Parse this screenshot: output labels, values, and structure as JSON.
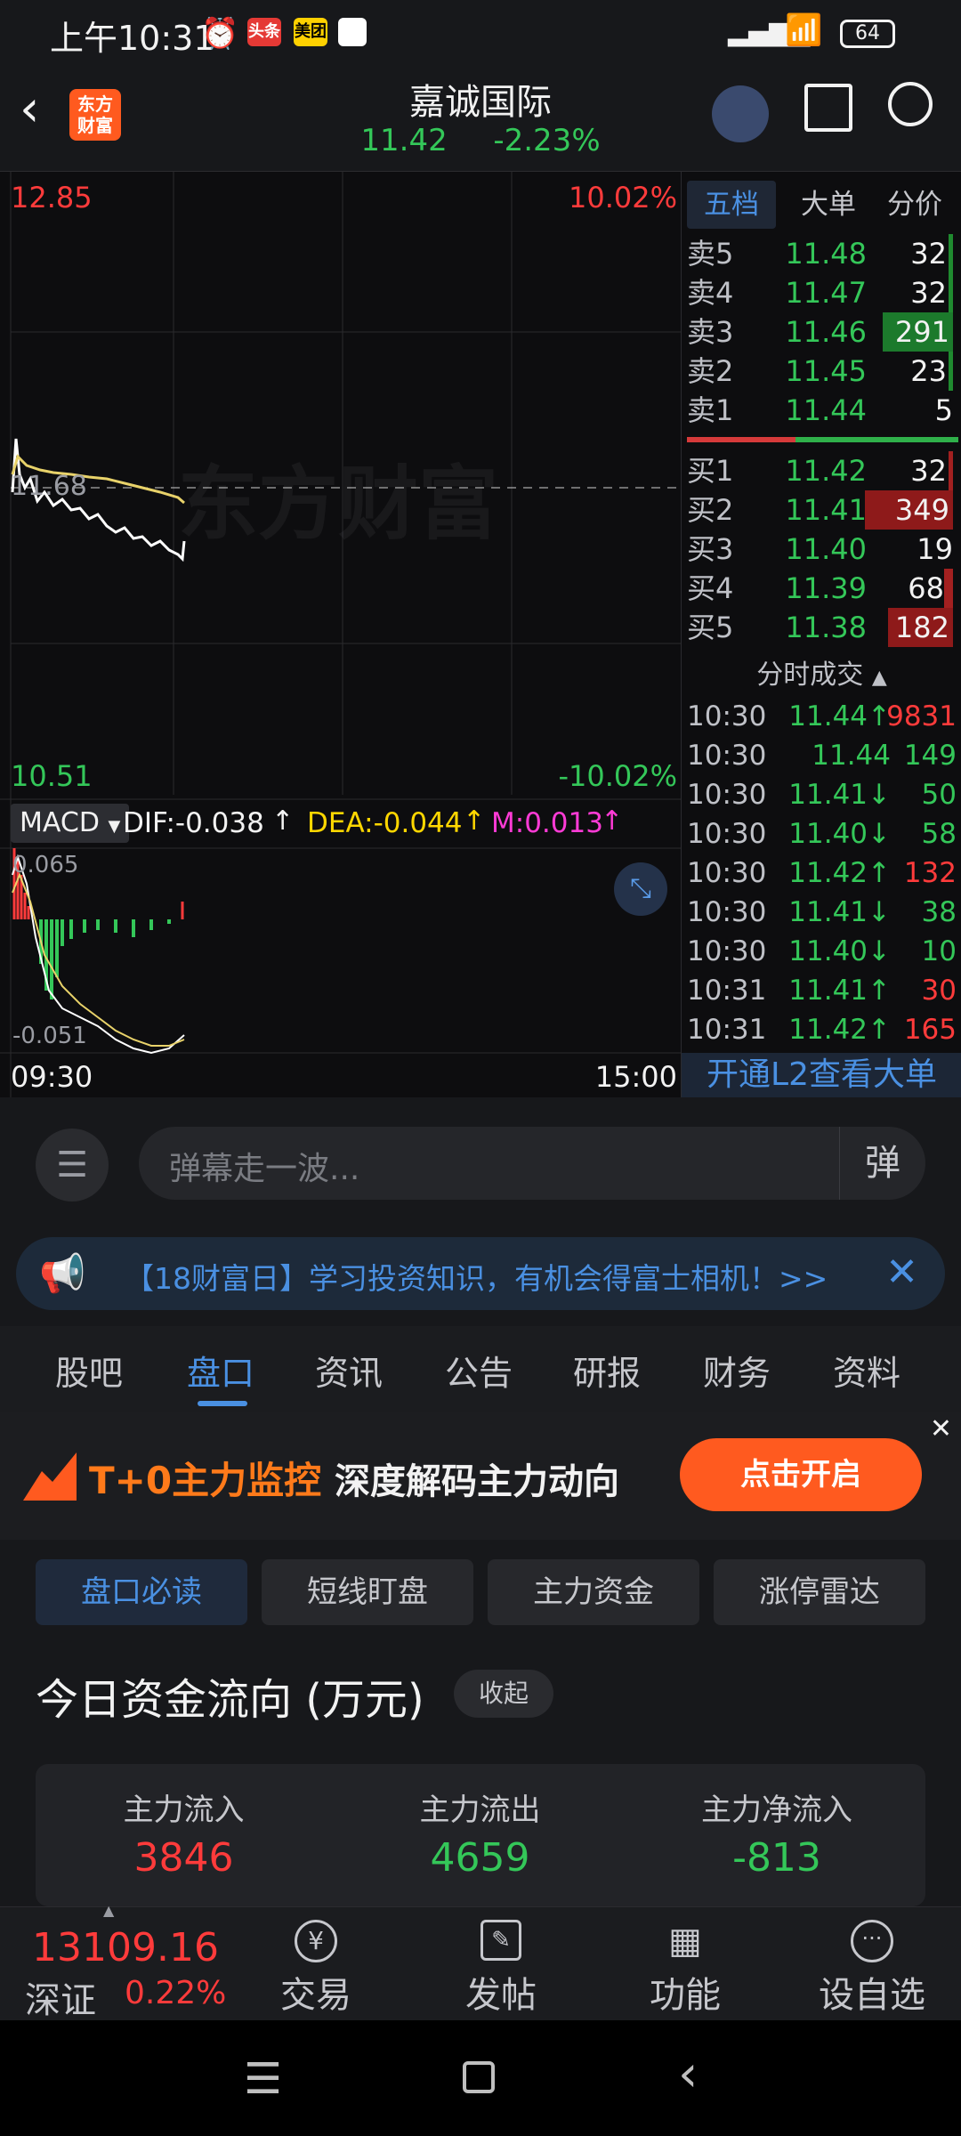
{
  "status": {
    "time": "上午10:31",
    "badges": [
      "头条",
      "美团"
    ],
    "battery": "64"
  },
  "header": {
    "logo_text": "东方\n财富",
    "title": "嘉诚国际",
    "price": "11.42",
    "change": "-2.23%"
  },
  "chart": {
    "top_price": "12.85",
    "top_pct": "10.02%",
    "bottom_price": "10.51",
    "bottom_pct": "-10.02%",
    "ref_price": "11.68",
    "watermark": "东方财富",
    "macd": {
      "label": "MACD",
      "dif": "DIF:-0.038",
      "dea": "DEA:-0.044",
      "m": "M:0.013",
      "top": "0.065",
      "bottom": "-0.051"
    },
    "time_start": "09:30",
    "time_end": "15:00"
  },
  "orderbook": {
    "tabs": [
      "五档",
      "大单",
      "分价"
    ],
    "sell": [
      {
        "label": "卖5",
        "price": "11.48",
        "vol": "32"
      },
      {
        "label": "卖4",
        "price": "11.47",
        "vol": "32"
      },
      {
        "label": "卖3",
        "price": "11.46",
        "vol": "291"
      },
      {
        "label": "卖2",
        "price": "11.45",
        "vol": "23"
      },
      {
        "label": "卖1",
        "price": "11.44",
        "vol": "5"
      }
    ],
    "buy": [
      {
        "label": "买1",
        "price": "11.42",
        "vol": "32"
      },
      {
        "label": "买2",
        "price": "11.41",
        "vol": "349"
      },
      {
        "label": "买3",
        "price": "11.40",
        "vol": "19"
      },
      {
        "label": "买4",
        "price": "11.39",
        "vol": "68"
      },
      {
        "label": "买5",
        "price": "11.38",
        "vol": "182"
      }
    ],
    "trades_title": "分时成交",
    "trades": [
      {
        "time": "10:30",
        "price": "11.44↑",
        "vol": "9831",
        "dir": "up"
      },
      {
        "time": "10:30",
        "price": "11.44",
        "vol": "149",
        "dir": "flat"
      },
      {
        "time": "10:30",
        "price": "11.41↓",
        "vol": "50",
        "dir": "down"
      },
      {
        "time": "10:30",
        "price": "11.40↓",
        "vol": "58",
        "dir": "down"
      },
      {
        "time": "10:30",
        "price": "11.42↑",
        "vol": "132",
        "dir": "up"
      },
      {
        "time": "10:30",
        "price": "11.41↓",
        "vol": "38",
        "dir": "down"
      },
      {
        "time": "10:30",
        "price": "11.40↓",
        "vol": "10",
        "dir": "down"
      },
      {
        "time": "10:31",
        "price": "11.41↑",
        "vol": "30",
        "dir": "up"
      },
      {
        "time": "10:31",
        "price": "11.42↑",
        "vol": "165",
        "dir": "up"
      }
    ],
    "l2_link": "开通L2查看大单"
  },
  "danmaku": {
    "placeholder": "弹幕走一波...",
    "button": "弹"
  },
  "notice": {
    "text": "【18财富日】学习投资知识，有机会得富士相机！>>"
  },
  "tabs": [
    "股吧",
    "盘口",
    "资讯",
    "公告",
    "研报",
    "财务",
    "资料"
  ],
  "ad": {
    "highlight": "T+0主力监控",
    "text": "深度解码主力动向",
    "button": "点击开启"
  },
  "chips": [
    "盘口必读",
    "短线盯盘",
    "主力资金",
    "涨停雷达"
  ],
  "flow": {
    "title": "今日资金流向 (万元)",
    "collapse": "收起",
    "items": [
      {
        "label": "主力流入",
        "value": "3846"
      },
      {
        "label": "主力流出",
        "value": "4659"
      },
      {
        "label": "主力净流入",
        "value": "-813"
      }
    ]
  },
  "bottom": {
    "index_value": "13109.16",
    "index_name": "深证",
    "index_change": "0.22%",
    "items": [
      "交易",
      "发帖",
      "功能",
      "设自选"
    ]
  },
  "colors": {
    "up": "#ff3b3b",
    "down": "#34c759",
    "accent": "#2f7bd6",
    "orange": "#ff5a1f"
  }
}
